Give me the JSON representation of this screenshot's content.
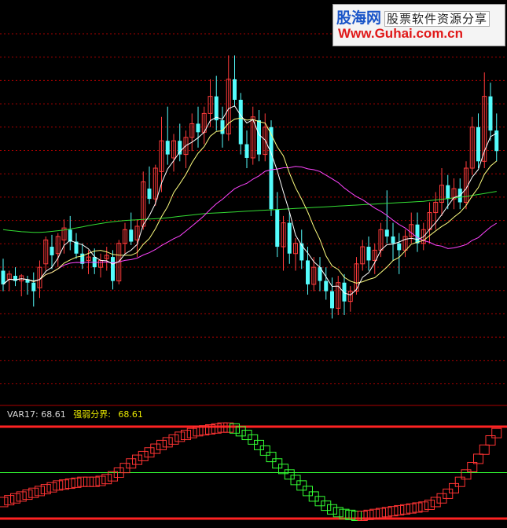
{
  "logo": {
    "site_name": "股海网",
    "tagline": "股票软件资源分享",
    "url": "Www.Guhai.com.cn"
  },
  "indicator": {
    "var17_label": "VAR17:",
    "var17_value": "68.61",
    "qiangruo_label": "强弱分界:",
    "qiangruo_value": "68.61"
  },
  "colors": {
    "background": "#000000",
    "up_candle": "#ff3b3b",
    "down_candle": "#54fcfc",
    "ma_white": "#ffffff",
    "ma_yellow": "#ffff80",
    "ma_magenta": "#ff44ff",
    "ma_green": "#33dd33",
    "grid_red": "#aa0000",
    "band_red": "#ff2222",
    "ind_up": "#ff3333",
    "ind_down": "#33ff33"
  },
  "chart_data": [
    {
      "type": "candlestick",
      "price_range": [
        0,
        100
      ],
      "grid": true,
      "candles": [
        {
          "o": 30.0,
          "h": 33.5,
          "l": 24.0,
          "c": 26.0
        },
        {
          "o": 27.5,
          "h": 30.0,
          "l": 24.0,
          "c": 29.0
        },
        {
          "o": 28.5,
          "h": 31.0,
          "l": 25.5,
          "c": 27.0
        },
        {
          "o": 27.0,
          "h": 29.0,
          "l": 22.5,
          "c": 28.5
        },
        {
          "o": 27.5,
          "h": 28.5,
          "l": 23.0,
          "c": 26.5
        },
        {
          "o": 26.5,
          "h": 29.5,
          "l": 19.5,
          "c": 24.0
        },
        {
          "o": 25.0,
          "h": 33.0,
          "l": 22.0,
          "c": 31.0
        },
        {
          "o": 32.0,
          "h": 40.0,
          "l": 30.0,
          "c": 39.0
        },
        {
          "o": 37.0,
          "h": 40.5,
          "l": 30.5,
          "c": 34.5
        },
        {
          "o": 35.0,
          "h": 41.0,
          "l": 31.0,
          "c": 40.0
        },
        {
          "o": 39.0,
          "h": 45.0,
          "l": 35.0,
          "c": 42.5
        },
        {
          "o": 42.0,
          "h": 46.0,
          "l": 36.0,
          "c": 38.5
        },
        {
          "o": 38.5,
          "h": 41.0,
          "l": 33.5,
          "c": 35.0
        },
        {
          "o": 35.0,
          "h": 38.0,
          "l": 30.5,
          "c": 32.0
        },
        {
          "o": 33.0,
          "h": 36.0,
          "l": 29.0,
          "c": 34.0
        },
        {
          "o": 34.0,
          "h": 36.5,
          "l": 29.0,
          "c": 31.0
        },
        {
          "o": 31.0,
          "h": 35.0,
          "l": 28.0,
          "c": 33.0
        },
        {
          "o": 33.5,
          "h": 37.0,
          "l": 30.0,
          "c": 34.5
        },
        {
          "o": 34.0,
          "h": 36.0,
          "l": 24.5,
          "c": 27.0
        },
        {
          "o": 27.0,
          "h": 39.0,
          "l": 26.0,
          "c": 38.0
        },
        {
          "o": 38.0,
          "h": 44.0,
          "l": 35.0,
          "c": 42.0
        },
        {
          "o": 42.0,
          "h": 47.0,
          "l": 37.5,
          "c": 38.5
        },
        {
          "o": 39.0,
          "h": 45.0,
          "l": 34.0,
          "c": 43.0
        },
        {
          "o": 43.0,
          "h": 59.0,
          "l": 42.0,
          "c": 56.0
        },
        {
          "o": 54.0,
          "h": 60.5,
          "l": 49.5,
          "c": 51.0
        },
        {
          "o": 51.0,
          "h": 61.0,
          "l": 49.0,
          "c": 60.0
        },
        {
          "o": 59.0,
          "h": 75.0,
          "l": 53.0,
          "c": 68.0
        },
        {
          "o": 68.0,
          "h": 78.0,
          "l": 61.0,
          "c": 64.0
        },
        {
          "o": 63.0,
          "h": 70.0,
          "l": 59.0,
          "c": 68.0
        },
        {
          "o": 68.0,
          "h": 73.0,
          "l": 62.0,
          "c": 64.0
        },
        {
          "o": 64.0,
          "h": 71.0,
          "l": 60.0,
          "c": 69.0
        },
        {
          "o": 69.0,
          "h": 76.0,
          "l": 65.0,
          "c": 73.0
        },
        {
          "o": 73.0,
          "h": 78.0,
          "l": 66.0,
          "c": 70.5
        },
        {
          "o": 70.5,
          "h": 78.0,
          "l": 67.0,
          "c": 76.0
        },
        {
          "o": 76.0,
          "h": 86.0,
          "l": 72.0,
          "c": 81.0
        },
        {
          "o": 81.0,
          "h": 87.0,
          "l": 71.0,
          "c": 74.0
        },
        {
          "o": 74.0,
          "h": 78.0,
          "l": 66.0,
          "c": 70.0
        },
        {
          "o": 70.0,
          "h": 93.0,
          "l": 68.0,
          "c": 86.0
        },
        {
          "o": 86.0,
          "h": 93.0,
          "l": 78.0,
          "c": 80.0
        },
        {
          "o": 80.0,
          "h": 82.0,
          "l": 64.0,
          "c": 67.0
        },
        {
          "o": 67.0,
          "h": 71.0,
          "l": 60.0,
          "c": 63.0
        },
        {
          "o": 63.0,
          "h": 78.0,
          "l": 61.0,
          "c": 75.0
        },
        {
          "o": 74.0,
          "h": 77.0,
          "l": 62.0,
          "c": 64.0
        },
        {
          "o": 64.0,
          "h": 76.0,
          "l": 62.0,
          "c": 72.0
        },
        {
          "o": 72.0,
          "h": 74.0,
          "l": 46.0,
          "c": 48.0
        },
        {
          "o": 48.0,
          "h": 53.0,
          "l": 34.0,
          "c": 37.0
        },
        {
          "o": 37.0,
          "h": 46.0,
          "l": 30.0,
          "c": 44.0
        },
        {
          "o": 44.0,
          "h": 47.0,
          "l": 32.0,
          "c": 35.0
        },
        {
          "o": 35.0,
          "h": 39.5,
          "l": 30.0,
          "c": 38.0
        },
        {
          "o": 38.0,
          "h": 42.0,
          "l": 30.5,
          "c": 33.0
        },
        {
          "o": 33.0,
          "h": 37.0,
          "l": 23.0,
          "c": 26.0
        },
        {
          "o": 26.0,
          "h": 34.0,
          "l": 24.0,
          "c": 31.0
        },
        {
          "o": 31.0,
          "h": 34.0,
          "l": 24.0,
          "c": 27.0
        },
        {
          "o": 27.0,
          "h": 31.0,
          "l": 21.5,
          "c": 24.0
        },
        {
          "o": 24.0,
          "h": 28.0,
          "l": 16.0,
          "c": 19.0
        },
        {
          "o": 19.0,
          "h": 28.5,
          "l": 17.0,
          "c": 26.5
        },
        {
          "o": 26.5,
          "h": 29.0,
          "l": 17.0,
          "c": 21.0
        },
        {
          "o": 21.0,
          "h": 25.5,
          "l": 18.0,
          "c": 24.0
        },
        {
          "o": 24.0,
          "h": 34.0,
          "l": 23.0,
          "c": 32.0
        },
        {
          "o": 32.0,
          "h": 39.0,
          "l": 30.0,
          "c": 37.0
        },
        {
          "o": 37.0,
          "h": 40.0,
          "l": 30.0,
          "c": 33.0
        },
        {
          "o": 33.0,
          "h": 38.0,
          "l": 29.0,
          "c": 36.0
        },
        {
          "o": 36.0,
          "h": 44.0,
          "l": 34.0,
          "c": 42.0
        },
        {
          "o": 42.0,
          "h": 53.5,
          "l": 38.0,
          "c": 40.0
        },
        {
          "o": 40.0,
          "h": 44.0,
          "l": 33.0,
          "c": 38.0
        },
        {
          "o": 38.0,
          "h": 41.0,
          "l": 29.0,
          "c": 36.0
        },
        {
          "o": 36.0,
          "h": 42.0,
          "l": 34.0,
          "c": 40.0
        },
        {
          "o": 40.0,
          "h": 47.0,
          "l": 38.0,
          "c": 43.5
        },
        {
          "o": 43.5,
          "h": 47.0,
          "l": 35.5,
          "c": 38.0
        },
        {
          "o": 38.0,
          "h": 44.0,
          "l": 36.0,
          "c": 42.0
        },
        {
          "o": 42.0,
          "h": 50.0,
          "l": 38.0,
          "c": 47.0
        },
        {
          "o": 47.0,
          "h": 53.0,
          "l": 42.0,
          "c": 50.0
        },
        {
          "o": 50.0,
          "h": 60.0,
          "l": 46.0,
          "c": 55.0
        },
        {
          "o": 55.0,
          "h": 58.0,
          "l": 48.0,
          "c": 51.0
        },
        {
          "o": 51.0,
          "h": 57.0,
          "l": 48.0,
          "c": 54.0
        },
        {
          "o": 54.0,
          "h": 57.0,
          "l": 48.0,
          "c": 50.0
        },
        {
          "o": 50.0,
          "h": 62.0,
          "l": 48.0,
          "c": 60.0
        },
        {
          "o": 60.0,
          "h": 75.0,
          "l": 58.0,
          "c": 72.0
        },
        {
          "o": 72.0,
          "h": 76.0,
          "l": 60.0,
          "c": 62.0
        },
        {
          "o": 62.0,
          "h": 88.0,
          "l": 60.0,
          "c": 81.0
        },
        {
          "o": 81.0,
          "h": 85.0,
          "l": 68.0,
          "c": 71.0
        },
        {
          "o": 71.0,
          "h": 76.0,
          "l": 62.0,
          "c": 65.0
        }
      ],
      "ma_periods": [
        5,
        10,
        30,
        120
      ],
      "ma_green_values": [
        42,
        41.8,
        41.6,
        41.4,
        41.3,
        41.2,
        41.2,
        41.3,
        41.5,
        41.7,
        41.9,
        42.2,
        42.5,
        42.8,
        43.2,
        43.5,
        43.8,
        44.1,
        44.3,
        44.5,
        44.7,
        44.8,
        44.9,
        45.0,
        45.1,
        45.2,
        45.3,
        45.5,
        45.7,
        45.9,
        46.1,
        46.3,
        46.5,
        46.7,
        46.8,
        46.9,
        47.0,
        47.1,
        47.2,
        47.3,
        47.4,
        47.5,
        47.6,
        47.7,
        47.8,
        47.9,
        48.0,
        48.1,
        48.2,
        48.3,
        48.4,
        48.5,
        48.6,
        48.7,
        48.8,
        48.9,
        49.0,
        49.1,
        49.2,
        49.3,
        49.4,
        49.5,
        49.6,
        49.7,
        49.8,
        49.9,
        50.0,
        50.1,
        50.2,
        50.3,
        50.5,
        50.7,
        50.9,
        51.1,
        51.3,
        51.5,
        51.7,
        52.0,
        52.3,
        52.6,
        52.9,
        53.2
      ]
    },
    {
      "type": "indicator",
      "y_range": [
        0,
        100
      ],
      "series_name": "VAR17",
      "levels": [
        100,
        50,
        0
      ],
      "values": [
        18,
        20,
        22,
        24,
        26,
        28,
        30,
        32,
        34,
        36,
        37,
        38,
        39,
        40,
        40,
        40,
        41,
        43,
        46,
        50,
        55,
        60,
        64,
        68,
        72,
        76,
        80,
        83,
        86,
        89,
        91,
        93,
        95,
        96,
        97,
        98,
        99,
        99,
        98,
        95,
        91,
        86,
        80,
        74,
        67,
        60,
        54,
        48,
        42,
        36,
        30,
        24,
        19,
        14,
        10,
        7,
        5,
        4,
        3,
        3,
        4,
        5,
        6,
        7,
        8,
        9,
        10,
        11,
        12,
        13,
        15,
        18,
        22,
        27,
        33,
        40,
        48,
        56,
        65,
        75,
        85,
        93
      ]
    }
  ]
}
